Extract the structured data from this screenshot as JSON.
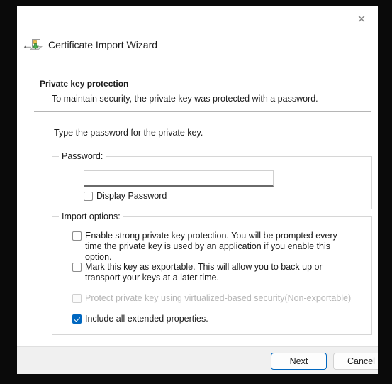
{
  "window": {
    "titlebar": {
      "back_icon": "back-arrow-icon",
      "app_icon": "certificate-import-icon",
      "title": "Certificate Import Wizard",
      "close_icon": "close-icon",
      "close_glyph": "✕",
      "back_glyph": "←"
    },
    "page": {
      "heading": "Private key protection",
      "subheading": "To maintain security, the private key was protected with a password.",
      "instruction": "Type the password for the private key."
    },
    "password_group": {
      "legend": "Password:",
      "input_value": "",
      "input_placeholder": "",
      "display_password": {
        "label": "Display Password",
        "checked": false,
        "disabled": false
      }
    },
    "import_options_group": {
      "legend": "Import options:",
      "options": [
        {
          "label": "Enable strong private key protection. You will be prompted every time the private key is used by an application if you enable this option.",
          "checked": false,
          "disabled": false
        },
        {
          "label": "Mark this key as exportable. This will allow you to back up or transport your keys at a later time.",
          "checked": false,
          "disabled": false
        },
        {
          "label": "Protect private key using virtualized-based security(Non-exportable)",
          "checked": false,
          "disabled": true
        },
        {
          "label": "Include all extended properties.",
          "checked": true,
          "disabled": false
        }
      ]
    },
    "footer": {
      "next_label": "Next",
      "cancel_label": "Cancel"
    },
    "colors": {
      "accent": "#0067c0",
      "dialog_background": "#ffffff",
      "footer_background": "#f0f0f0",
      "text": "#1b1b1b",
      "disabled_text": "#b6b6b6",
      "border": "#d6d6d6"
    }
  }
}
